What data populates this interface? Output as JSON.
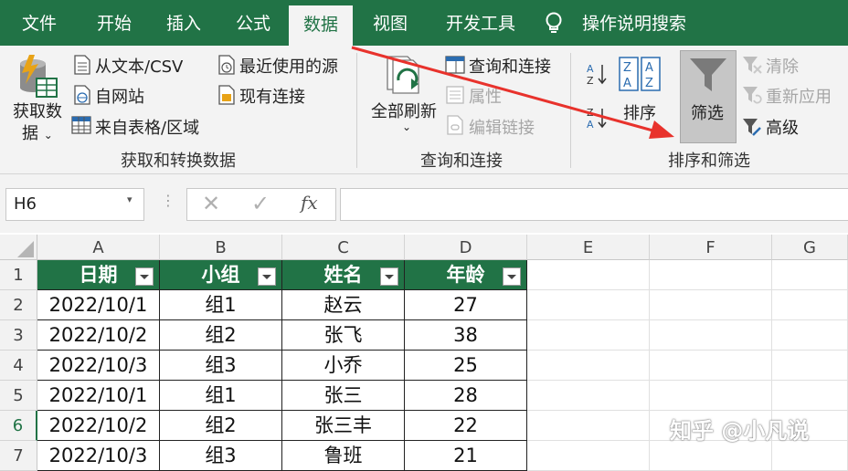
{
  "tabs": [
    "文件",
    "开始",
    "插入",
    "公式",
    "数据",
    "视图",
    "开发工具"
  ],
  "tell_me": "操作说明搜索",
  "ribbon": {
    "get_data_line1": "获取数",
    "get_data_line2": "据",
    "from_text_csv": "从文本/CSV",
    "from_web": "自网站",
    "from_table": "来自表格/区域",
    "recent_sources": "最近使用的源",
    "existing_connections": "现有连接",
    "group_get_transform": "获取和转换数据",
    "refresh_all": "全部刷新",
    "queries_connections": "查询和连接",
    "properties": "属性",
    "edit_links": "编辑链接",
    "group_queries": "查询和连接",
    "sort": "排序",
    "filter": "筛选",
    "clear": "清除",
    "reapply": "重新应用",
    "advanced": "高级",
    "group_sort_filter": "排序和筛选"
  },
  "formula_bar": {
    "name_box": "H6",
    "fx": "fx",
    "formula": ""
  },
  "grid": {
    "columns": [
      "A",
      "B",
      "C",
      "D",
      "E",
      "F",
      "G"
    ],
    "rows": [
      "1",
      "2",
      "3",
      "4",
      "5",
      "6",
      "7"
    ],
    "headers": [
      "日期",
      "小组",
      "姓名",
      "年龄"
    ],
    "data": [
      [
        "2022/10/1",
        "组1",
        "赵云",
        "27"
      ],
      [
        "2022/10/2",
        "组2",
        "张飞",
        "38"
      ],
      [
        "2022/10/3",
        "组3",
        "小乔",
        "25"
      ],
      [
        "2022/10/1",
        "组1",
        "张三",
        "28"
      ],
      [
        "2022/10/2",
        "组2",
        "张三丰",
        "22"
      ],
      [
        "2022/10/3",
        "组3",
        "鲁班",
        "21"
      ]
    ]
  },
  "watermark": "知乎 @小凡说",
  "colors": {
    "excel_green": "#217346",
    "arrow_red": "#e8322c"
  }
}
